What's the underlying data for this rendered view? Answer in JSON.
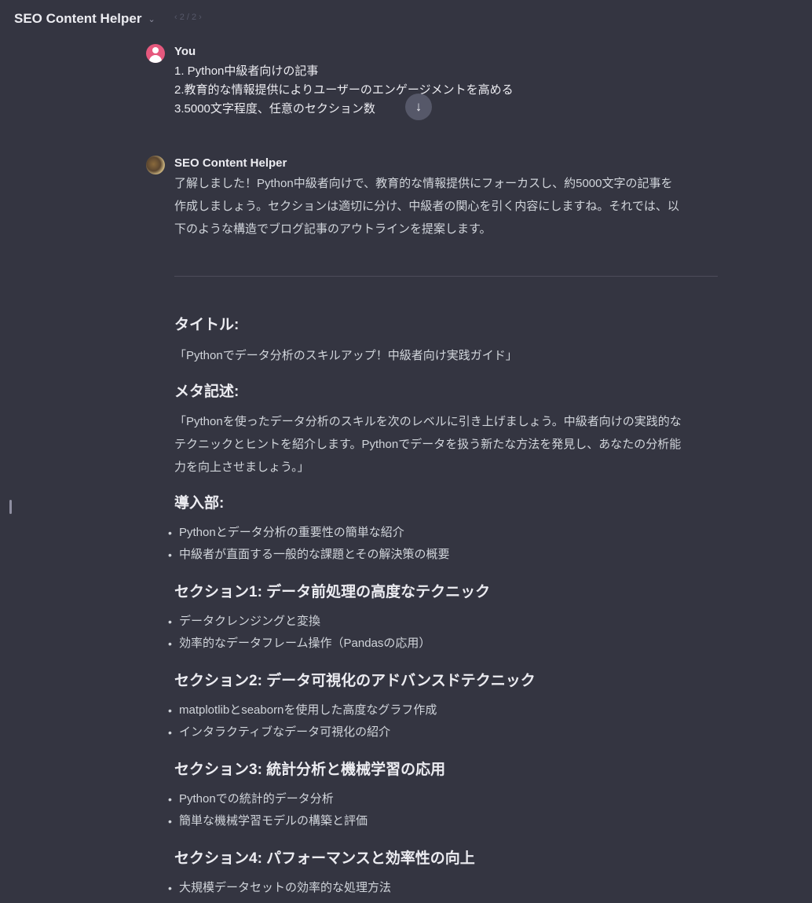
{
  "header": {
    "title": "SEO Content Helper",
    "pager": "‹ 2 / 2 ›"
  },
  "user_message": {
    "author": "You",
    "lines": [
      "1. Python中級者向けの記事",
      "2.教育的な情報提供によりユーザーのエンゲージメントを高める",
      "3.5000文字程度、任意のセクション数"
    ]
  },
  "scroll_down_icon": "arrow-down-icon",
  "bot_message": {
    "author": "SEO Content Helper",
    "intro_lines": [
      "了解しました！Python中級者向けで、教育的な情報提供にフォーカスし、約5000文字の記事を",
      "作成しましょう。セクションは適切に分け、中級者の関心を引く内容にしますね。それでは、以",
      "下のような構造でブログ記事のアウトラインを提案します。"
    ]
  },
  "outline": {
    "title_heading": "タイトル:",
    "title_text": "「Pythonでデータ分析のスキルアップ！中級者向け実践ガイド」",
    "meta_heading": "メタ記述:",
    "meta_lines": [
      "「Pythonを使ったデータ分析のスキルを次のレベルに引き上げましょう。中級者向けの実践的な",
      "テクニックとヒントを紹介します。Pythonでデータを扱う新たな方法を発見し、あなたの分析能",
      "力を向上させましょう。」"
    ],
    "sections": [
      {
        "heading": "導入部:",
        "bullets": [
          "Pythonとデータ分析の重要性の簡単な紹介",
          "中級者が直面する一般的な課題とその解決策の概要"
        ]
      },
      {
        "heading": "セクション1: データ前処理の高度なテクニック",
        "bullets": [
          "データクレンジングと変換",
          "効率的なデータフレーム操作（Pandasの応用）"
        ]
      },
      {
        "heading": "セクション2: データ可視化のアドバンスドテクニック",
        "bullets": [
          "matplotlibとseabornを使用した高度なグラフ作成",
          "インタラクティブなデータ可視化の紹介"
        ]
      },
      {
        "heading": "セクション3: 統計分析と機械学習の応用",
        "bullets": [
          "Pythonでの統計的データ分析",
          "簡単な機械学習モデルの構築と評価"
        ]
      },
      {
        "heading": "セクション4: パフォーマンスと効率性の向上",
        "bullets": [
          "大規模データセットの効率的な処理方法"
        ]
      }
    ]
  }
}
